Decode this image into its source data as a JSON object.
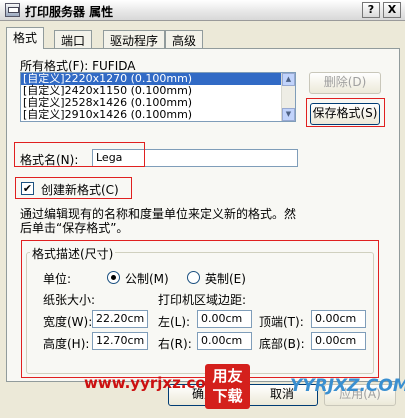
{
  "window": {
    "title": "打印服务器 属性",
    "help_label": "?",
    "close_label": "X"
  },
  "tabs": [
    {
      "label": "格式",
      "active": true
    },
    {
      "label": "端口",
      "active": false
    },
    {
      "label": "驱动程序",
      "active": false
    },
    {
      "label": "高级",
      "active": false
    }
  ],
  "forms": {
    "all_formats_label": "所有格式(F):  FUFIDA",
    "items": [
      "[自定义]2220x1270 (0.100mm)",
      "[自定义]2420x1150 (0.100mm)",
      "[自定义]2528x1426 (0.100mm)",
      "[自定义]2910x1426 (0.100mm)"
    ],
    "selected_index": 0,
    "delete_label": "删除(D)",
    "save_label": "保存格式(S)",
    "name_label": "格式名(N):",
    "name_value": "Lega",
    "create_label": "创建新格式(C)",
    "create_checked": true,
    "create_mark": "✔",
    "description_line1": "通过编辑现有的名称和度量单位来定义新的格式。然",
    "description_line2": "后单击“保存格式”。"
  },
  "format_desc": {
    "title": "格式描述(尺寸)",
    "unit_label": "单位:",
    "metric_label": "公制(M)",
    "english_label": "英制(E)",
    "selected_unit": "metric",
    "paper_size_label": "纸张大小:",
    "margins_label": "打印机区域边距:",
    "width_label": "宽度(W):",
    "width_value": "22.20cm",
    "height_label": "高度(H):",
    "height_value": "12.70cm",
    "left_label": "左(L):",
    "left_value": "0.00cm",
    "right_label": "右(R):",
    "right_value": "0.00cm",
    "top_label": "顶端(T):",
    "top_value": "0.00cm",
    "bottom_label": "底部(B):",
    "bottom_value": "0.00cm"
  },
  "buttons": {
    "ok_label": "确定",
    "cancel_label": "取消",
    "apply_label": "应用(A)"
  },
  "watermark": {
    "url": "www.yyrjxz.com",
    "logo_line1": "用友",
    "logo_line2": "下载",
    "brand": "YYRJXZ.COM"
  },
  "colors": {
    "annotation_red": "#e02020",
    "selection_blue": "#316ac5",
    "dialog_background": "#ece9d8"
  }
}
